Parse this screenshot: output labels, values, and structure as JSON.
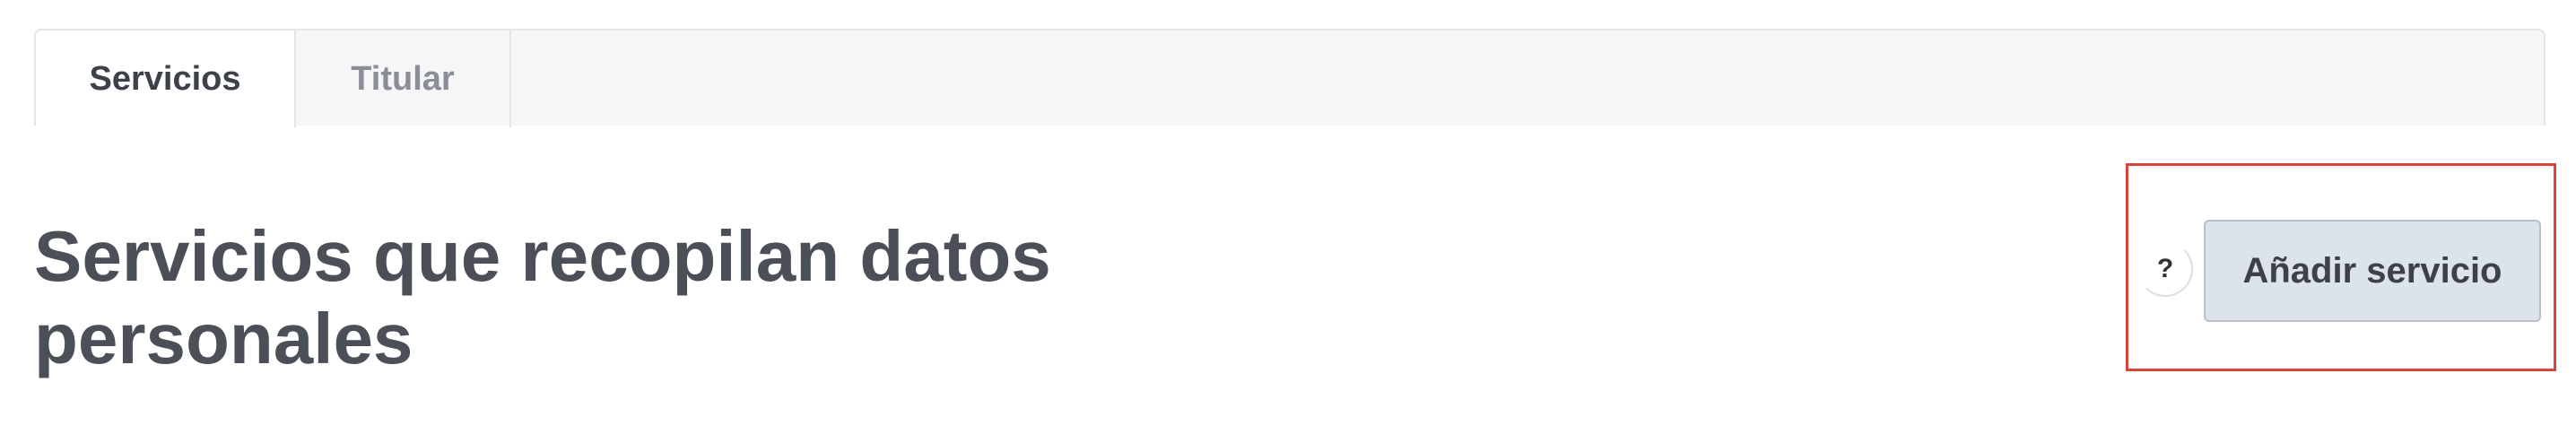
{
  "tabs": [
    {
      "label": "Servicios",
      "active": true
    },
    {
      "label": "Titular",
      "active": false
    }
  ],
  "main": {
    "title": "Servicios que recopilan datos personales"
  },
  "actions": {
    "help_label": "?",
    "add_service_label": "Añadir servicio"
  },
  "colors": {
    "title_text": "#4a4f58",
    "button_bg": "#dde3ed",
    "highlight_border": "#d9433a",
    "tab_bar_bg": "#f6f6f7"
  }
}
